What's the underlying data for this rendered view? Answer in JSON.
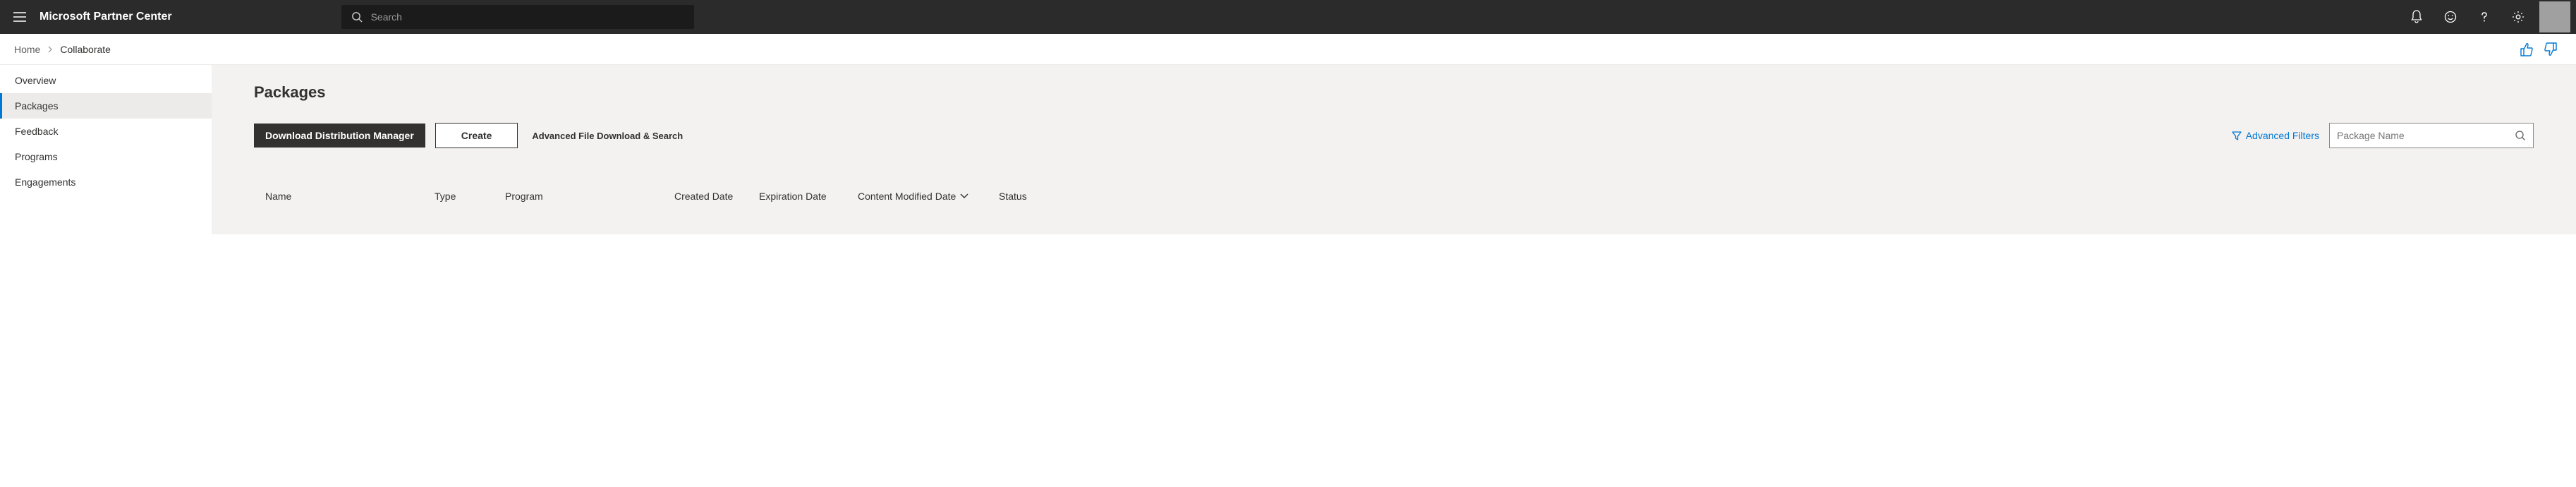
{
  "header": {
    "brand": "Microsoft Partner Center",
    "search_placeholder": "Search"
  },
  "breadcrumb": {
    "home": "Home",
    "current": "Collaborate"
  },
  "sidebar": {
    "items": [
      {
        "label": "Overview",
        "active": false
      },
      {
        "label": "Packages",
        "active": true
      },
      {
        "label": "Feedback",
        "active": false
      },
      {
        "label": "Programs",
        "active": false
      },
      {
        "label": "Engagements",
        "active": false
      }
    ]
  },
  "main": {
    "title": "Packages",
    "download_btn": "Download Distribution Manager",
    "create_btn": "Create",
    "advanced_download": "Advanced File Download & Search",
    "advanced_filters": "Advanced Filters",
    "package_filter_placeholder": "Package Name",
    "columns": {
      "name": "Name",
      "type": "Type",
      "program": "Program",
      "created": "Created Date",
      "expiration": "Expiration Date",
      "modified": "Content Modified Date",
      "status": "Status"
    }
  }
}
